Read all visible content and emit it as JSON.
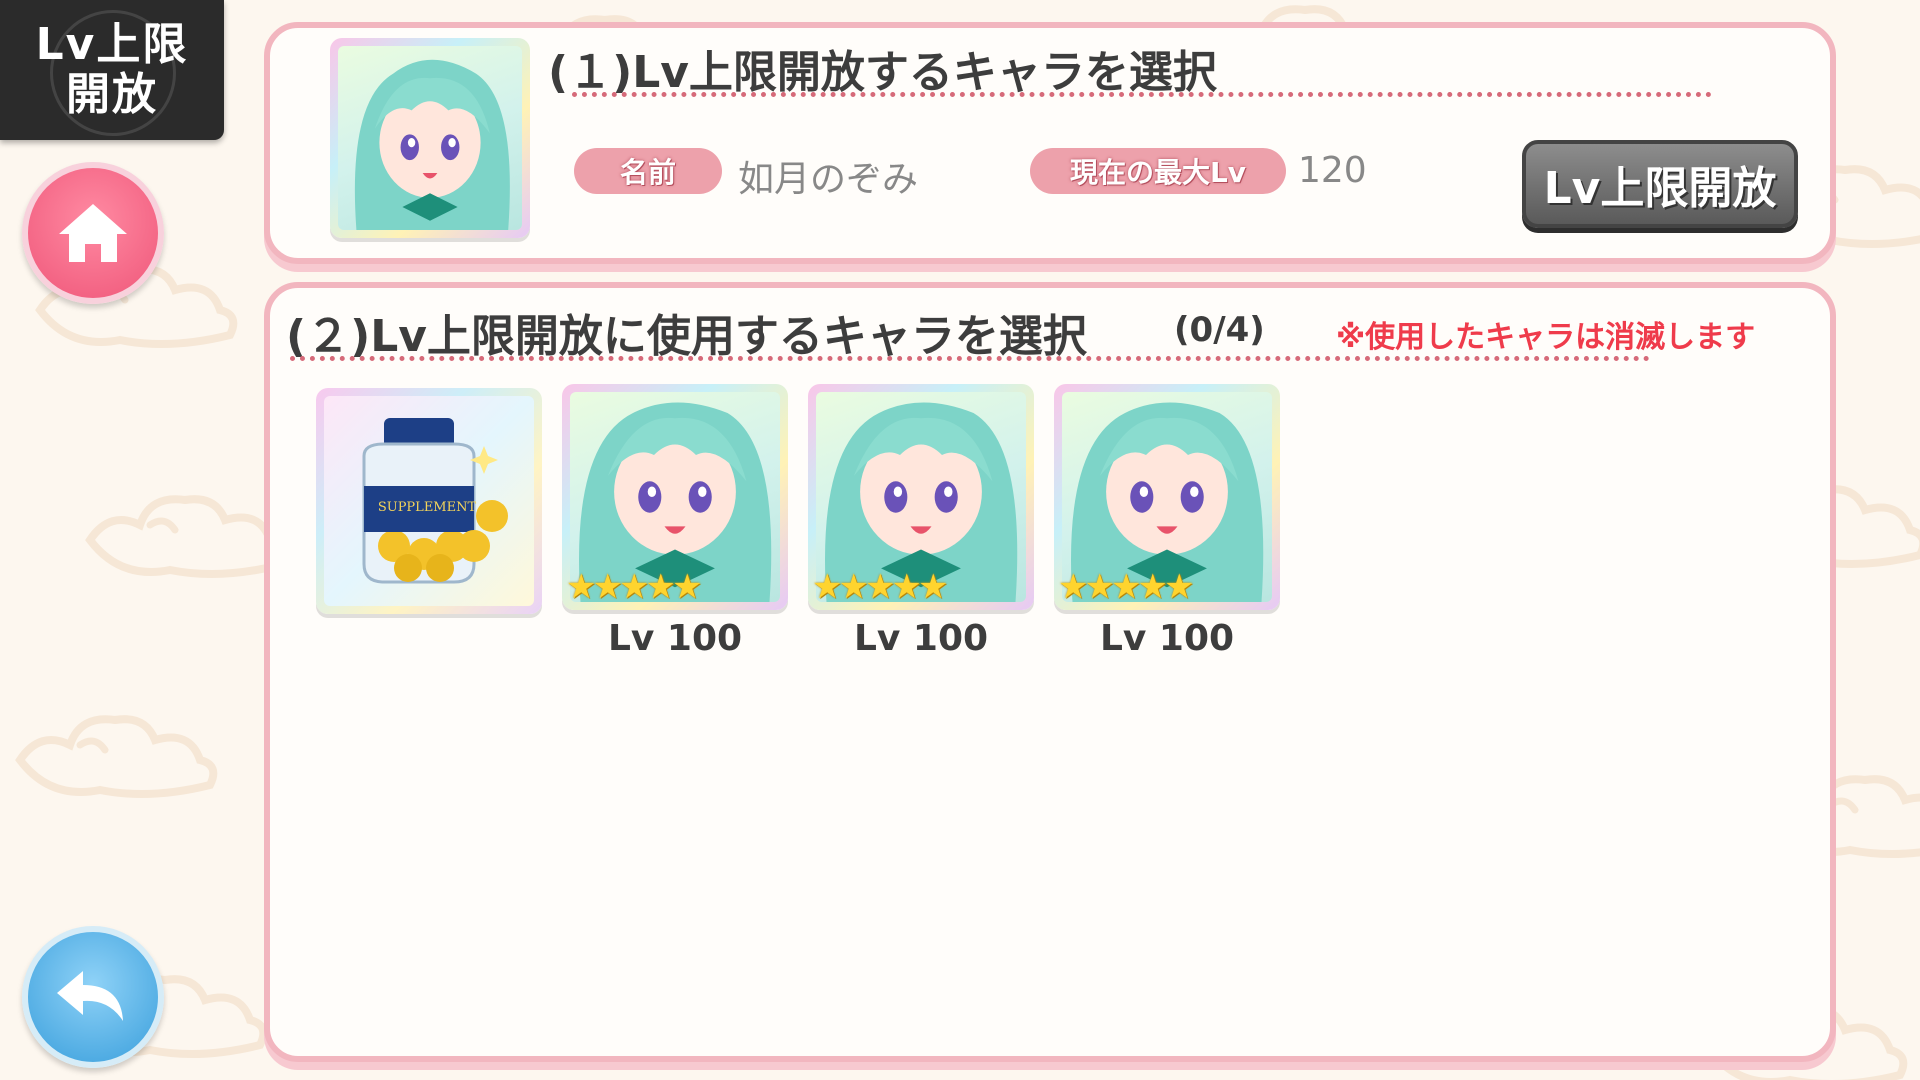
{
  "screen": {
    "badge_line1": "Lv上限",
    "badge_line2": "開放"
  },
  "section1": {
    "title": "(１)Lv上限開放するキャラを選択",
    "name_label": "名前",
    "name_value": "如月のぞみ",
    "max_lv_label": "現在の最大Lv",
    "max_lv_value": "120",
    "unlock_button": "Lv上限開放"
  },
  "section2": {
    "title": "(２)Lv上限開放に使用するキャラを選択",
    "count": "(0/4)",
    "warning": "※使用したキャラは消滅します",
    "materials": [
      {
        "type": "item",
        "label": "SUPPLEMENT"
      },
      {
        "type": "character",
        "stars": 5,
        "level": "Lv 100"
      },
      {
        "type": "character",
        "stars": 5,
        "level": "Lv 100"
      },
      {
        "type": "character",
        "stars": 5,
        "level": "Lv 100"
      }
    ]
  },
  "icons": {
    "home": "home-icon",
    "back": "back-arrow-icon"
  },
  "colors": {
    "panel_border": "#f2b6bf",
    "label_pill": "#eda1ab",
    "warning": "#ef3b4b",
    "home_button": "#ef5679",
    "back_button": "#3a9fdc"
  }
}
